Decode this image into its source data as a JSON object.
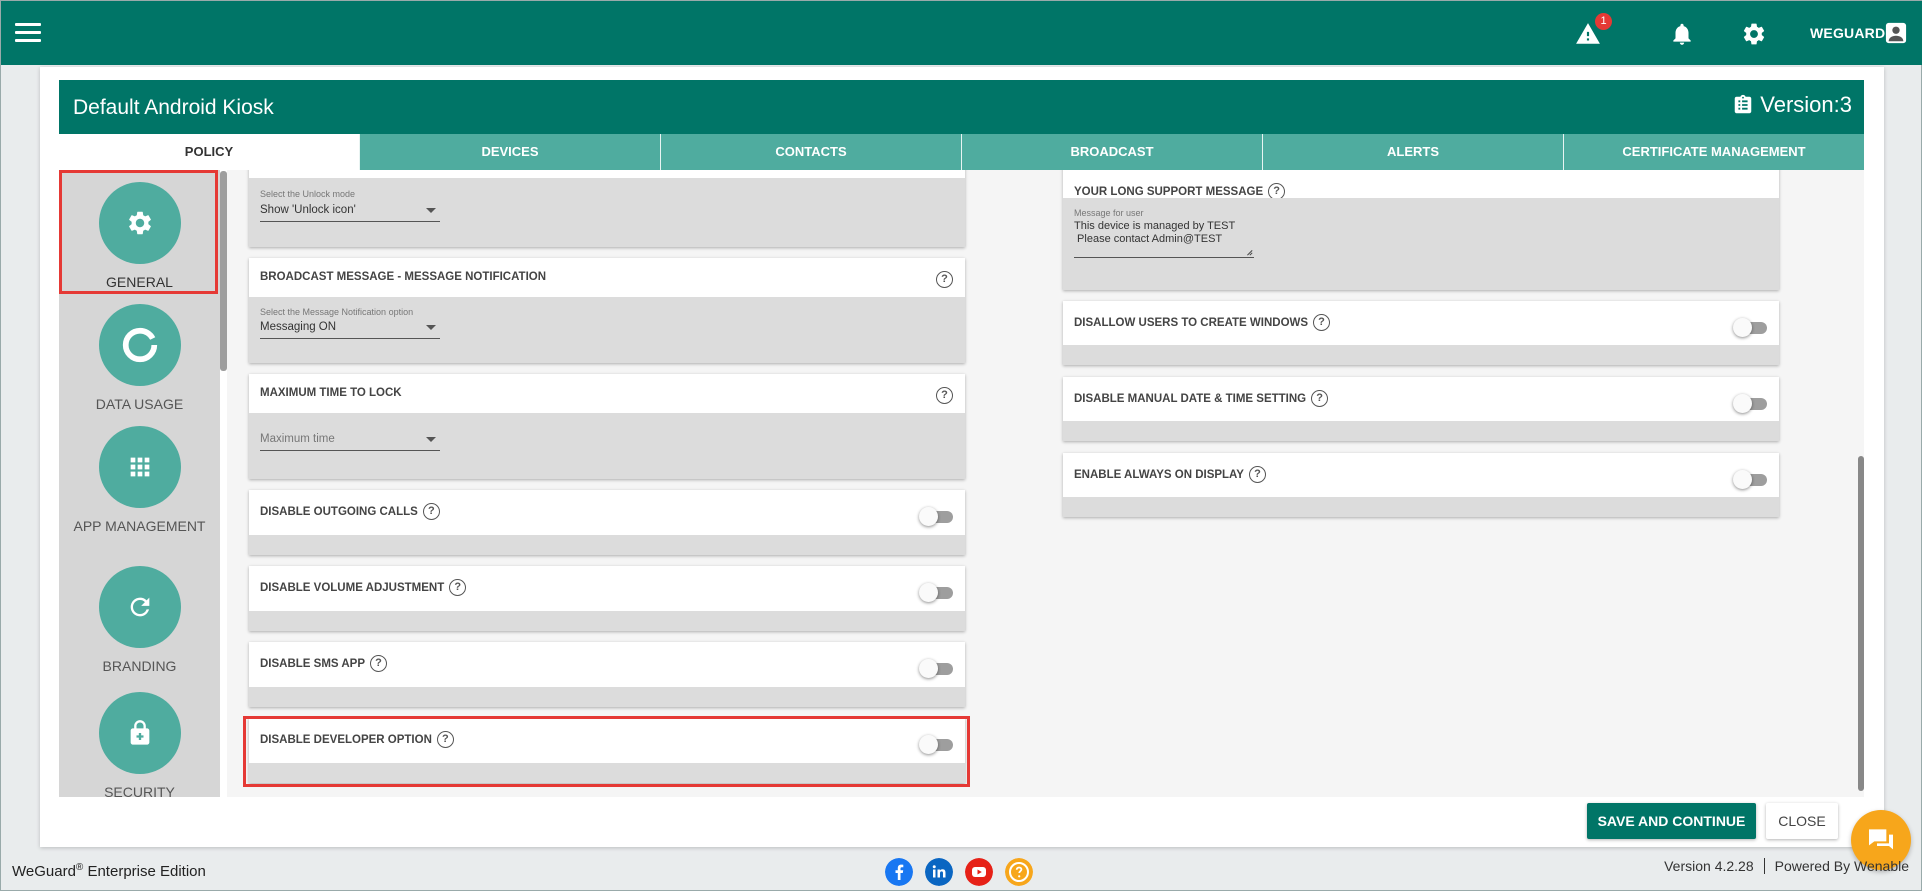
{
  "topbar": {
    "alert_count": "1",
    "user_name": "WEGUARD"
  },
  "card": {
    "title": "Default Android Kiosk",
    "version": "Version:3"
  },
  "tabs": [
    "POLICY",
    "DEVICES",
    "CONTACTS",
    "BROADCAST",
    "ALERTS",
    "CERTIFICATE MANAGEMENT"
  ],
  "leftnav": [
    {
      "label": "GENERAL",
      "icon": "gear-icon"
    },
    {
      "label": "DATA USAGE",
      "icon": "donut-chart-icon"
    },
    {
      "label": "APP MANAGEMENT",
      "icon": "apps-grid-icon"
    },
    {
      "label": "BRANDING",
      "icon": "refresh-icon"
    },
    {
      "label": "SECURITY",
      "icon": "lock-icon"
    }
  ],
  "left_panels": {
    "unlock": {
      "select_label": "Select the Unlock mode",
      "select_value": "Show 'Unlock icon'"
    },
    "broadcast": {
      "title": "BROADCAST MESSAGE - MESSAGE NOTIFICATION",
      "select_label": "Select the Message Notification option",
      "select_value": "Messaging ON"
    },
    "max_lock": {
      "title": "MAXIMUM TIME TO LOCK",
      "select_placeholder": "Maximum time"
    },
    "outgoing_calls": {
      "title": "DISABLE OUTGOING CALLS",
      "enabled": false
    },
    "volume": {
      "title": "DISABLE VOLUME ADJUSTMENT",
      "enabled": false
    },
    "sms": {
      "title": "DISABLE SMS APP",
      "enabled": false
    },
    "developer": {
      "title": "DISABLE DEVELOPER OPTION",
      "enabled": false
    }
  },
  "right_panels": {
    "support": {
      "title": "YOUR LONG SUPPORT MESSAGE",
      "field_label": "Message for user",
      "field_value": "This device is managed by TEST\n Please contact Admin@TEST"
    },
    "windows": {
      "title": "DISALLOW USERS TO CREATE WINDOWS",
      "enabled": false
    },
    "datetime": {
      "title": "DISABLE MANUAL DATE & TIME SETTING",
      "enabled": false
    },
    "always_on": {
      "title": "ENABLE ALWAYS ON DISPLAY",
      "enabled": false
    }
  },
  "help_glyph": "?",
  "buttons": {
    "save": "SAVE AND CONTINUE",
    "close": "CLOSE"
  },
  "footer": {
    "edition_brand": "WeGuard",
    "edition_mark": "®",
    "edition_text": " Enterprise Edition",
    "version": "Version 4.2.28",
    "powered": "Powered By Wenable"
  },
  "colors": {
    "primary": "#007567",
    "tab": "#4fac9f",
    "highlight": "#e53935",
    "chat": "#f7a61b"
  }
}
